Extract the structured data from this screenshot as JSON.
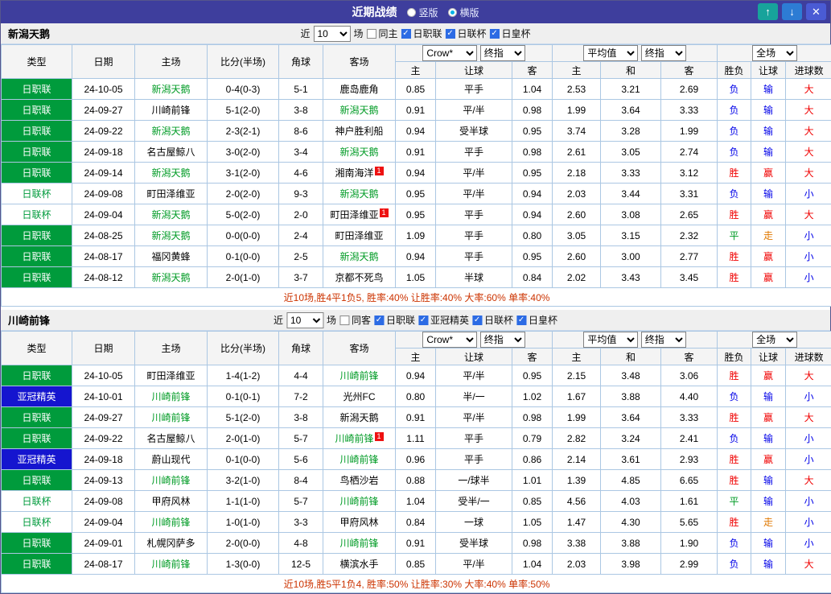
{
  "titlebar": {
    "title": "近期战绩",
    "vertical_label": "竖版",
    "horizontal_label": "横版",
    "selected_layout": "横版",
    "up_button": "↑",
    "down_button": "↓",
    "close_button": "✕"
  },
  "colors": {
    "titlebar_bg": "#3e3e9d",
    "win": "#f00000",
    "loss": "#0000e8",
    "draw": "#009b25",
    "push": "#e07800",
    "score": "#ff5500",
    "focus_team": "#009b25",
    "league_jleague_bg": "#009b3c",
    "league_acl_bg": "#1515cf",
    "grid_border": "#abc7e3",
    "summary_text": "#cc3300"
  },
  "sections": [
    {
      "team": "新潟天鹅",
      "filter": {
        "near": "近",
        "count": "10",
        "games": "场",
        "same_label": "同主",
        "same_checked": false,
        "leagues": [
          {
            "label": "日职联",
            "checked": true
          },
          {
            "label": "日联杯",
            "checked": true
          },
          {
            "label": "日皇杯",
            "checked": true
          }
        ]
      },
      "header": {
        "cols": [
          "类型",
          "日期",
          "主场",
          "比分(半场)",
          "角球",
          "客场"
        ],
        "bookmaker": "Crow*",
        "odds_stage1": "终指",
        "average": "平均值",
        "odds_stage2": "终指",
        "fulltime": "全场",
        "sub1": [
          "主",
          "让球",
          "客"
        ],
        "sub2": [
          "主",
          "和",
          "客"
        ],
        "sub3": [
          "胜负",
          "让球",
          "进球数"
        ]
      },
      "rows": [
        {
          "league": "日职联",
          "league_class": "lg-green",
          "date": "24-10-05",
          "home": "新潟天鹅",
          "home_focus": true,
          "home_card": false,
          "score": "0-4(0-3)",
          "corner": "5-1",
          "away": "鹿岛鹿角",
          "away_focus": false,
          "away_card": false,
          "crown_home": "0.85",
          "handicap": "平手",
          "crown_away": "1.04",
          "avg_home": "2.53",
          "avg_draw": "3.21",
          "avg_away": "2.69",
          "res_wl": "负",
          "res_wl_c": "blue",
          "res_h": "输",
          "res_h_c": "blue",
          "res_g": "大",
          "res_g_c": "red"
        },
        {
          "league": "日职联",
          "league_class": "lg-green",
          "date": "24-09-27",
          "home": "川崎前锋",
          "home_focus": false,
          "home_card": false,
          "score": "5-1(2-0)",
          "corner": "3-8",
          "away": "新潟天鹅",
          "away_focus": true,
          "away_card": false,
          "crown_home": "0.91",
          "handicap": "平/半",
          "crown_away": "0.98",
          "avg_home": "1.99",
          "avg_draw": "3.64",
          "avg_away": "3.33",
          "res_wl": "负",
          "res_wl_c": "blue",
          "res_h": "输",
          "res_h_c": "blue",
          "res_g": "大",
          "res_g_c": "red"
        },
        {
          "league": "日职联",
          "league_class": "lg-green",
          "date": "24-09-22",
          "home": "新潟天鹅",
          "home_focus": true,
          "home_card": false,
          "score": "2-3(2-1)",
          "corner": "8-6",
          "away": "神户胜利船",
          "away_focus": false,
          "away_card": false,
          "crown_home": "0.94",
          "handicap": "受半球",
          "crown_away": "0.95",
          "avg_home": "3.74",
          "avg_draw": "3.28",
          "avg_away": "1.99",
          "res_wl": "负",
          "res_wl_c": "blue",
          "res_h": "输",
          "res_h_c": "blue",
          "res_g": "大",
          "res_g_c": "red"
        },
        {
          "league": "日职联",
          "league_class": "lg-green",
          "date": "24-09-18",
          "home": "名古屋鲸八",
          "home_focus": false,
          "home_card": false,
          "score": "3-0(2-0)",
          "corner": "3-4",
          "away": "新潟天鹅",
          "away_focus": true,
          "away_card": false,
          "crown_home": "0.91",
          "handicap": "平手",
          "crown_away": "0.98",
          "avg_home": "2.61",
          "avg_draw": "3.05",
          "avg_away": "2.74",
          "res_wl": "负",
          "res_wl_c": "blue",
          "res_h": "输",
          "res_h_c": "blue",
          "res_g": "大",
          "res_g_c": "red"
        },
        {
          "league": "日职联",
          "league_class": "lg-green",
          "date": "24-09-14",
          "home": "新潟天鹅",
          "home_focus": true,
          "home_card": false,
          "score": "3-1(2-0)",
          "corner": "4-6",
          "away": "湘南海洋",
          "away_focus": false,
          "away_card": true,
          "crown_home": "0.94",
          "handicap": "平/半",
          "crown_away": "0.95",
          "avg_home": "2.18",
          "avg_draw": "3.33",
          "avg_away": "3.12",
          "res_wl": "胜",
          "res_wl_c": "red",
          "res_h": "赢",
          "res_h_c": "red",
          "res_g": "大",
          "res_g_c": "red"
        },
        {
          "league": "日联杯",
          "league_class": "lg-cup",
          "date": "24-09-08",
          "home": "町田泽维亚",
          "home_focus": false,
          "home_card": false,
          "score": "2-0(2-0)",
          "corner": "9-3",
          "away": "新潟天鹅",
          "away_focus": true,
          "away_card": false,
          "crown_home": "0.95",
          "handicap": "平/半",
          "crown_away": "0.94",
          "avg_home": "2.03",
          "avg_draw": "3.44",
          "avg_away": "3.31",
          "res_wl": "负",
          "res_wl_c": "blue",
          "res_h": "输",
          "res_h_c": "blue",
          "res_g": "小",
          "res_g_c": "blue"
        },
        {
          "league": "日联杯",
          "league_class": "lg-cup",
          "date": "24-09-04",
          "home": "新潟天鹅",
          "home_focus": true,
          "home_card": false,
          "score": "5-0(2-0)",
          "corner": "2-0",
          "away": "町田泽维亚",
          "away_focus": false,
          "away_card": true,
          "crown_home": "0.95",
          "handicap": "平手",
          "crown_away": "0.94",
          "avg_home": "2.60",
          "avg_draw": "3.08",
          "avg_away": "2.65",
          "res_wl": "胜",
          "res_wl_c": "red",
          "res_h": "赢",
          "res_h_c": "red",
          "res_g": "大",
          "res_g_c": "red"
        },
        {
          "league": "日职联",
          "league_class": "lg-green",
          "date": "24-08-25",
          "home": "新潟天鹅",
          "home_focus": true,
          "home_card": false,
          "score": "0-0(0-0)",
          "corner": "2-4",
          "away": "町田泽维亚",
          "away_focus": false,
          "away_card": false,
          "crown_home": "1.09",
          "handicap": "平手",
          "crown_away": "0.80",
          "avg_home": "3.05",
          "avg_draw": "3.15",
          "avg_away": "2.32",
          "res_wl": "平",
          "res_wl_c": "green",
          "res_h": "走",
          "res_h_c": "orange",
          "res_g": "小",
          "res_g_c": "blue"
        },
        {
          "league": "日职联",
          "league_class": "lg-green",
          "date": "24-08-17",
          "home": "福冈黄蜂",
          "home_focus": false,
          "home_card": false,
          "score": "0-1(0-0)",
          "corner": "2-5",
          "away": "新潟天鹅",
          "away_focus": true,
          "away_card": false,
          "crown_home": "0.94",
          "handicap": "平手",
          "crown_away": "0.95",
          "avg_home": "2.60",
          "avg_draw": "3.00",
          "avg_away": "2.77",
          "res_wl": "胜",
          "res_wl_c": "red",
          "res_h": "赢",
          "res_h_c": "red",
          "res_g": "小",
          "res_g_c": "blue"
        },
        {
          "league": "日职联",
          "league_class": "lg-green",
          "date": "24-08-12",
          "home": "新潟天鹅",
          "home_focus": true,
          "home_card": false,
          "score": "2-0(1-0)",
          "corner": "3-7",
          "away": "京都不死鸟",
          "away_focus": false,
          "away_card": false,
          "crown_home": "1.05",
          "handicap": "半球",
          "crown_away": "0.84",
          "avg_home": "2.02",
          "avg_draw": "3.43",
          "avg_away": "3.45",
          "res_wl": "胜",
          "res_wl_c": "red",
          "res_h": "赢",
          "res_h_c": "red",
          "res_g": "小",
          "res_g_c": "blue"
        }
      ],
      "summary": "近10场,胜4平1负5, 胜率:40% 让胜率:40% 大率:60% 单率:40%"
    },
    {
      "team": "川崎前锋",
      "filter": {
        "near": "近",
        "count": "10",
        "games": "场",
        "same_label": "同客",
        "same_checked": false,
        "leagues": [
          {
            "label": "日职联",
            "checked": true
          },
          {
            "label": "亚冠精英",
            "checked": true
          },
          {
            "label": "日联杯",
            "checked": true
          },
          {
            "label": "日皇杯",
            "checked": true
          }
        ]
      },
      "header": {
        "cols": [
          "类型",
          "日期",
          "主场",
          "比分(半场)",
          "角球",
          "客场"
        ],
        "bookmaker": "Crow*",
        "odds_stage1": "终指",
        "average": "平均值",
        "odds_stage2": "终指",
        "fulltime": "全场",
        "sub1": [
          "主",
          "让球",
          "客"
        ],
        "sub2": [
          "主",
          "和",
          "客"
        ],
        "sub3": [
          "胜负",
          "让球",
          "进球数"
        ]
      },
      "rows": [
        {
          "league": "日职联",
          "league_class": "lg-green",
          "date": "24-10-05",
          "home": "町田泽维亚",
          "home_focus": false,
          "home_card": false,
          "score": "1-4(1-2)",
          "corner": "4-4",
          "away": "川崎前锋",
          "away_focus": true,
          "away_card": false,
          "crown_home": "0.94",
          "handicap": "平/半",
          "crown_away": "0.95",
          "avg_home": "2.15",
          "avg_draw": "3.48",
          "avg_away": "3.06",
          "res_wl": "胜",
          "res_wl_c": "red",
          "res_h": "赢",
          "res_h_c": "red",
          "res_g": "大",
          "res_g_c": "red"
        },
        {
          "league": "亚冠精英",
          "league_class": "lg-blue",
          "date": "24-10-01",
          "home": "川崎前锋",
          "home_focus": true,
          "home_card": false,
          "score": "0-1(0-1)",
          "corner": "7-2",
          "away": "光州FC",
          "away_focus": false,
          "away_card": false,
          "crown_home": "0.80",
          "handicap": "半/一",
          "crown_away": "1.02",
          "avg_home": "1.67",
          "avg_draw": "3.88",
          "avg_away": "4.40",
          "res_wl": "负",
          "res_wl_c": "blue",
          "res_h": "输",
          "res_h_c": "blue",
          "res_g": "小",
          "res_g_c": "blue"
        },
        {
          "league": "日职联",
          "league_class": "lg-green",
          "date": "24-09-27",
          "home": "川崎前锋",
          "home_focus": true,
          "home_card": false,
          "score": "5-1(2-0)",
          "corner": "3-8",
          "away": "新潟天鹅",
          "away_focus": false,
          "away_card": false,
          "crown_home": "0.91",
          "handicap": "平/半",
          "crown_away": "0.98",
          "avg_home": "1.99",
          "avg_draw": "3.64",
          "avg_away": "3.33",
          "res_wl": "胜",
          "res_wl_c": "red",
          "res_h": "赢",
          "res_h_c": "red",
          "res_g": "大",
          "res_g_c": "red"
        },
        {
          "league": "日职联",
          "league_class": "lg-green",
          "date": "24-09-22",
          "home": "名古屋鲸八",
          "home_focus": false,
          "home_card": false,
          "score": "2-0(1-0)",
          "corner": "5-7",
          "away": "川崎前锋",
          "away_focus": true,
          "away_card": true,
          "crown_home": "1.11",
          "handicap": "平手",
          "crown_away": "0.79",
          "avg_home": "2.82",
          "avg_draw": "3.24",
          "avg_away": "2.41",
          "res_wl": "负",
          "res_wl_c": "blue",
          "res_h": "输",
          "res_h_c": "blue",
          "res_g": "小",
          "res_g_c": "blue"
        },
        {
          "league": "亚冠精英",
          "league_class": "lg-blue",
          "date": "24-09-18",
          "home": "蔚山现代",
          "home_focus": false,
          "home_card": false,
          "score": "0-1(0-0)",
          "corner": "5-6",
          "away": "川崎前锋",
          "away_focus": true,
          "away_card": false,
          "crown_home": "0.96",
          "handicap": "平手",
          "crown_away": "0.86",
          "avg_home": "2.14",
          "avg_draw": "3.61",
          "avg_away": "2.93",
          "res_wl": "胜",
          "res_wl_c": "red",
          "res_h": "赢",
          "res_h_c": "red",
          "res_g": "小",
          "res_g_c": "blue"
        },
        {
          "league": "日职联",
          "league_class": "lg-green",
          "date": "24-09-13",
          "home": "川崎前锋",
          "home_focus": true,
          "home_card": false,
          "score": "3-2(1-0)",
          "corner": "8-4",
          "away": "鸟栖沙岩",
          "away_focus": false,
          "away_card": false,
          "crown_home": "0.88",
          "handicap": "一/球半",
          "crown_away": "1.01",
          "avg_home": "1.39",
          "avg_draw": "4.85",
          "avg_away": "6.65",
          "res_wl": "胜",
          "res_wl_c": "red",
          "res_h": "输",
          "res_h_c": "blue",
          "res_g": "大",
          "res_g_c": "red"
        },
        {
          "league": "日联杯",
          "league_class": "lg-cup",
          "date": "24-09-08",
          "home": "甲府风林",
          "home_focus": false,
          "home_card": false,
          "score": "1-1(1-0)",
          "corner": "5-7",
          "away": "川崎前锋",
          "away_focus": true,
          "away_card": false,
          "crown_home": "1.04",
          "handicap": "受半/一",
          "crown_away": "0.85",
          "avg_home": "4.56",
          "avg_draw": "4.03",
          "avg_away": "1.61",
          "res_wl": "平",
          "res_wl_c": "green",
          "res_h": "输",
          "res_h_c": "blue",
          "res_g": "小",
          "res_g_c": "blue"
        },
        {
          "league": "日联杯",
          "league_class": "lg-cup",
          "date": "24-09-04",
          "home": "川崎前锋",
          "home_focus": true,
          "home_card": false,
          "score": "1-0(1-0)",
          "corner": "3-3",
          "away": "甲府风林",
          "away_focus": false,
          "away_card": false,
          "crown_home": "0.84",
          "handicap": "一球",
          "crown_away": "1.05",
          "avg_home": "1.47",
          "avg_draw": "4.30",
          "avg_away": "5.65",
          "res_wl": "胜",
          "res_wl_c": "red",
          "res_h": "走",
          "res_h_c": "orange",
          "res_g": "小",
          "res_g_c": "blue"
        },
        {
          "league": "日职联",
          "league_class": "lg-green",
          "date": "24-09-01",
          "home": "札幌冈萨多",
          "home_focus": false,
          "home_card": false,
          "score": "2-0(0-0)",
          "corner": "4-8",
          "away": "川崎前锋",
          "away_focus": true,
          "away_card": false,
          "crown_home": "0.91",
          "handicap": "受半球",
          "crown_away": "0.98",
          "avg_home": "3.38",
          "avg_draw": "3.88",
          "avg_away": "1.90",
          "res_wl": "负",
          "res_wl_c": "blue",
          "res_h": "输",
          "res_h_c": "blue",
          "res_g": "小",
          "res_g_c": "blue"
        },
        {
          "league": "日职联",
          "league_class": "lg-green",
          "date": "24-08-17",
          "home": "川崎前锋",
          "home_focus": true,
          "home_card": false,
          "score": "1-3(0-0)",
          "corner": "12-5",
          "away": "横滨水手",
          "away_focus": false,
          "away_card": false,
          "crown_home": "0.85",
          "handicap": "平/半",
          "crown_away": "1.04",
          "avg_home": "2.03",
          "avg_draw": "3.98",
          "avg_away": "2.99",
          "res_wl": "负",
          "res_wl_c": "blue",
          "res_h": "输",
          "res_h_c": "blue",
          "res_g": "大",
          "res_g_c": "red"
        }
      ],
      "summary": "近10场,胜5平1负4, 胜率:50% 让胜率:30% 大率:40% 单率:50%"
    }
  ]
}
